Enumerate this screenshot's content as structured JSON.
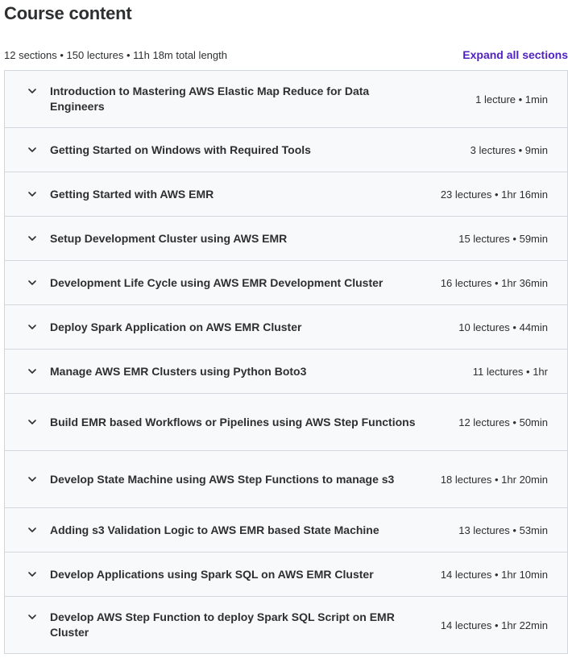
{
  "header": {
    "title": "Course content",
    "summary": "12 sections • 150 lectures • 11h 18m total length",
    "expand_label": "Expand all sections"
  },
  "colors": {
    "accent": "#5022c3",
    "section_bg": "#f7f9fa",
    "border": "#d1d7dc",
    "text": "#2d2f31"
  },
  "icons": {
    "section_toggle": "chevron-down-icon"
  },
  "sections": [
    {
      "title": "Introduction to Mastering AWS Elastic Map Reduce for Data Engineers",
      "meta": "1 lecture • 1min"
    },
    {
      "title": "Getting Started on Windows with Required Tools",
      "meta": "3 lectures • 9min"
    },
    {
      "title": "Getting Started with AWS EMR",
      "meta": "23 lectures • 1hr 16min"
    },
    {
      "title": "Setup Development Cluster using AWS EMR",
      "meta": "15 lectures • 59min"
    },
    {
      "title": "Development Life Cycle using AWS EMR Development Cluster",
      "meta": "16 lectures • 1hr 36min"
    },
    {
      "title": "Deploy Spark Application on AWS EMR Cluster",
      "meta": "10 lectures • 44min"
    },
    {
      "title": "Manage AWS EMR Clusters using Python Boto3",
      "meta": "11 lectures • 1hr"
    },
    {
      "title": "Build EMR based Workflows or Pipelines using AWS Step Functions",
      "meta": "12 lectures • 50min"
    },
    {
      "title": "Develop State Machine using AWS Step Functions to manage s3",
      "meta": "18 lectures • 1hr 20min"
    },
    {
      "title": "Adding s3 Validation Logic to AWS EMR based State Machine",
      "meta": "13 lectures • 53min"
    },
    {
      "title": "Develop Applications using Spark SQL on AWS EMR Cluster",
      "meta": "14 lectures • 1hr 10min"
    },
    {
      "title": "Develop AWS Step Function to deploy Spark SQL Script on EMR Cluster",
      "meta": "14 lectures • 1hr 22min"
    }
  ]
}
